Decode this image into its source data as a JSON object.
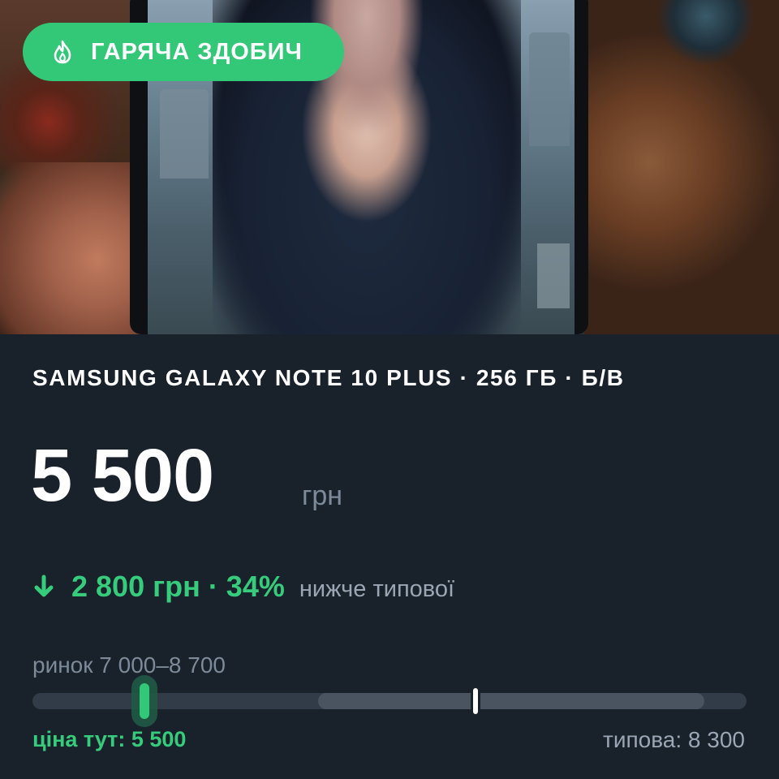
{
  "badge": {
    "label": "ГАРЯЧА ЗДОБИЧ",
    "icon": "flame-icon",
    "color": "#32c878"
  },
  "listing": {
    "title": "SAMSUNG GALAXY NOTE 10 PLUS · 256 ГБ · Б/В",
    "price": "5 500",
    "currency": "грн"
  },
  "savings": {
    "icon": "arrow-down-icon",
    "amount": "2 800 грн · 34%",
    "note": "нижче типової"
  },
  "market": {
    "label": "ринок 7 000–8 700",
    "price_here": "ціна тут: 5 500",
    "typical": "типова: 8 300"
  },
  "colors": {
    "accent": "#32c878",
    "background": "#19212b"
  }
}
